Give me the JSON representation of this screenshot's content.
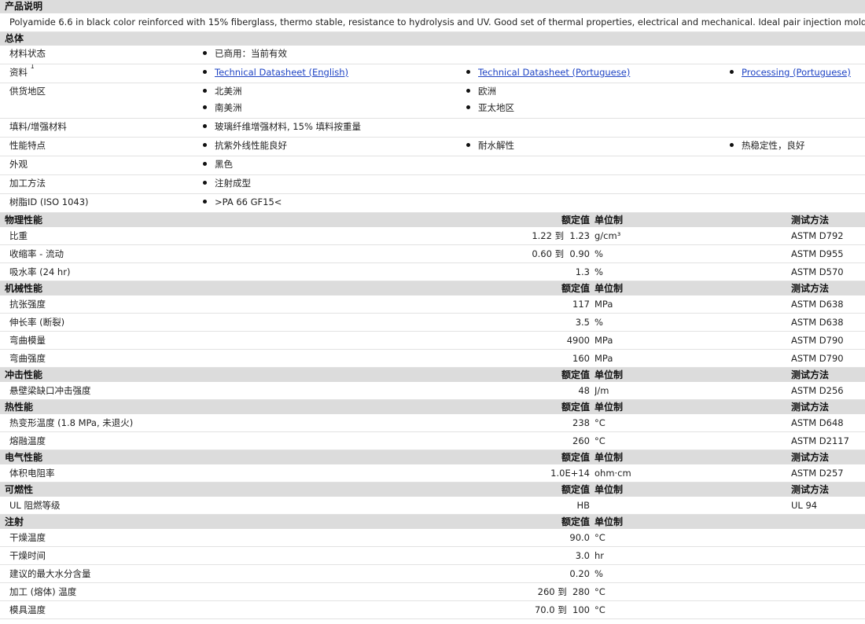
{
  "product_description": {
    "header": "产品说明",
    "text": "Polyamide 6.6 in black color reinforced with 15% fiberglass, thermo stable, resistance to hydrolysis and UV. Good set of thermal properties, electrical and mechanical. Ideal pair injection molding."
  },
  "general": {
    "header": "总体",
    "rows": [
      {
        "label": "材料状态",
        "cols": [
          [
            "已商用：当前有效"
          ],
          [],
          []
        ]
      },
      {
        "label": "资料",
        "sup": "1",
        "links": true,
        "cols": [
          [
            "Technical Datasheet (English)"
          ],
          [
            "Technical Datasheet (Portuguese)"
          ],
          [
            "Processing (Portuguese)"
          ]
        ]
      },
      {
        "label": "供货地区",
        "cols": [
          [
            "北美洲",
            "南美洲"
          ],
          [
            "欧洲",
            "亚太地区"
          ],
          []
        ]
      },
      {
        "label": "填料/增强材料",
        "cols": [
          [
            "玻璃纤维增强材料, 15% 填料按重量"
          ],
          [],
          []
        ]
      },
      {
        "label": "性能特点",
        "cols": [
          [
            "抗紫外线性能良好"
          ],
          [
            "耐水解性"
          ],
          [
            "热稳定性，良好"
          ]
        ]
      },
      {
        "label": "外观",
        "cols": [
          [
            "黑色"
          ],
          [],
          []
        ]
      },
      {
        "label": "加工方法",
        "cols": [
          [
            "注射成型"
          ],
          [],
          []
        ]
      },
      {
        "label": "树脂ID (ISO 1043)",
        "cols": [
          [
            ">PA 66 GF15<"
          ],
          [],
          []
        ]
      }
    ]
  },
  "column_headers": {
    "nominal": "额定值",
    "unit": "单位制",
    "method": "测试方法"
  },
  "sections": [
    {
      "name": "物理性能",
      "show_method": true,
      "rows": [
        {
          "prop": "比重",
          "value": "1.22 到  1.23",
          "unit": "g/cm³",
          "method": "ASTM D792"
        },
        {
          "prop": "收缩率 - 流动",
          "value": "0.60 到  0.90",
          "unit": "%",
          "method": "ASTM D955"
        },
        {
          "prop": "吸水率 (24 hr)",
          "value": "1.3",
          "unit": "%",
          "method": "ASTM D570"
        }
      ]
    },
    {
      "name": "机械性能",
      "show_method": true,
      "rows": [
        {
          "prop": "抗张强度",
          "value": "117",
          "unit": "MPa",
          "method": "ASTM D638"
        },
        {
          "prop": "伸长率 (断裂)",
          "value": "3.5",
          "unit": "%",
          "method": "ASTM D638"
        },
        {
          "prop": "弯曲模量",
          "value": "4900",
          "unit": "MPa",
          "method": "ASTM D790"
        },
        {
          "prop": "弯曲强度",
          "value": "160",
          "unit": "MPa",
          "method": "ASTM D790"
        }
      ]
    },
    {
      "name": "冲击性能",
      "show_method": true,
      "rows": [
        {
          "prop": "悬壁梁缺口冲击强度",
          "value": "48",
          "unit": "J/m",
          "method": "ASTM D256"
        }
      ]
    },
    {
      "name": "热性能",
      "show_method": true,
      "rows": [
        {
          "prop": "热变形温度 (1.8 MPa, 未退火)",
          "value": "238",
          "unit": "°C",
          "method": "ASTM D648"
        },
        {
          "prop": "熔融温度",
          "value": "260",
          "unit": "°C",
          "method": "ASTM D2117"
        }
      ]
    },
    {
      "name": "电气性能",
      "show_method": true,
      "rows": [
        {
          "prop": "体积电阻率",
          "value": "1.0E+14",
          "unit": "ohm·cm",
          "method": "ASTM D257"
        }
      ]
    },
    {
      "name": "可燃性",
      "show_method": true,
      "rows": [
        {
          "prop": "UL 阻燃等级",
          "value": "HB",
          "unit": "",
          "method": "UL 94"
        }
      ]
    },
    {
      "name": "注射",
      "show_method": false,
      "rows": [
        {
          "prop": "干燥温度",
          "value": "90.0",
          "unit": "°C",
          "method": ""
        },
        {
          "prop": "干燥时间",
          "value": "3.0",
          "unit": "hr",
          "method": ""
        },
        {
          "prop": "建议的最大水分含量",
          "value": "0.20",
          "unit": "%",
          "method": ""
        },
        {
          "prop": "加工 (熔体) 温度",
          "value": "260 到  280",
          "unit": "°C",
          "method": ""
        },
        {
          "prop": "模具温度",
          "value": "70.0 到  100",
          "unit": "°C",
          "method": ""
        }
      ]
    }
  ]
}
